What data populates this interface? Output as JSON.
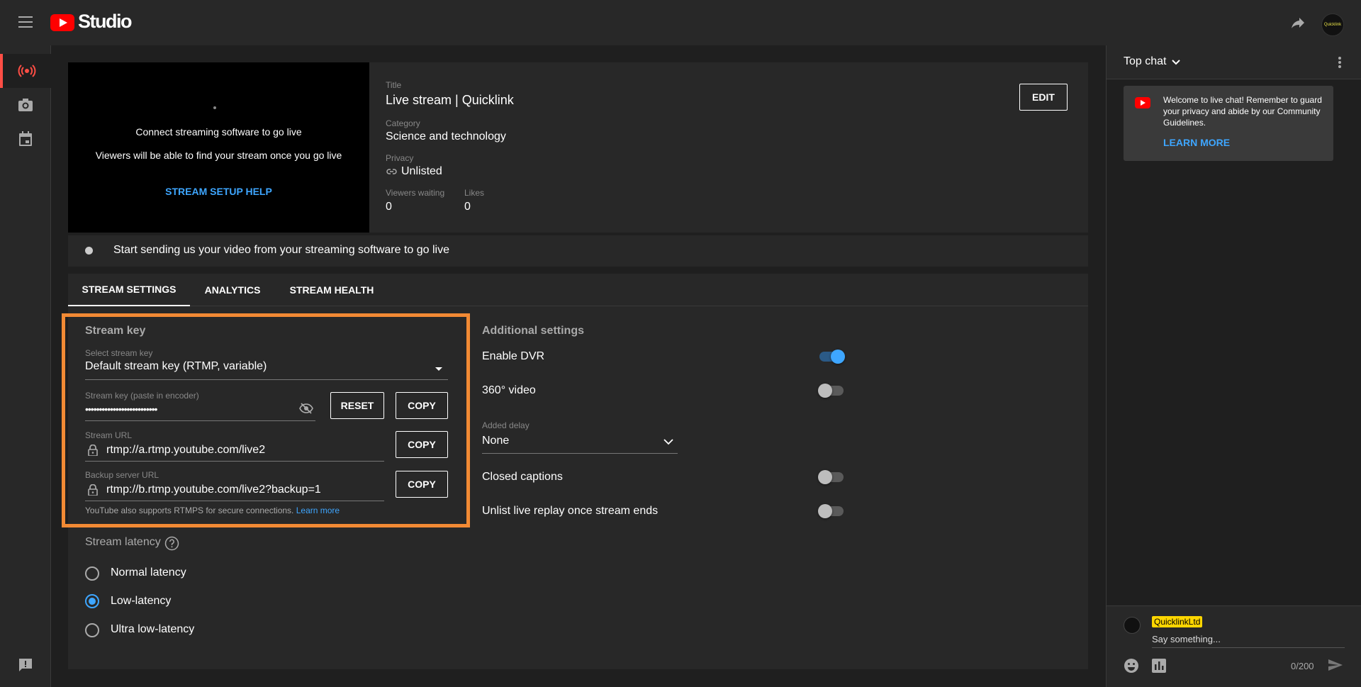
{
  "header": {
    "logo_text": "Studio",
    "avatar_text": "Quicklink"
  },
  "preview": {
    "line1": "Connect streaming software to go live",
    "line2": "Viewers will be able to find your stream once you go live",
    "help_link": "STREAM SETUP HELP"
  },
  "details": {
    "title_label": "Title",
    "title_value": "Live stream | Quicklink",
    "category_label": "Category",
    "category_value": "Science and technology",
    "privacy_label": "Privacy",
    "privacy_value": "Unlisted",
    "viewers_label": "Viewers waiting",
    "viewers_value": "0",
    "likes_label": "Likes",
    "likes_value": "0",
    "edit_button": "EDIT"
  },
  "status_bar": {
    "text": "Start sending us your video from your streaming software to go live"
  },
  "tabs": [
    {
      "label": "STREAM SETTINGS",
      "active": true
    },
    {
      "label": "ANALYTICS",
      "active": false
    },
    {
      "label": "STREAM HEALTH",
      "active": false
    }
  ],
  "stream_key": {
    "heading": "Stream key",
    "select_label": "Select stream key",
    "select_value": "Default stream key (RTMP, variable)",
    "key_label": "Stream key (paste in encoder)",
    "key_value": "••••••••••••••••••••••••••",
    "reset_button": "RESET",
    "copy_button": "COPY",
    "url_label": "Stream URL",
    "url_value": "rtmp://a.rtmp.youtube.com/live2",
    "backup_label": "Backup server URL",
    "backup_value": "rtmp://b.rtmp.youtube.com/live2?backup=1",
    "rtmps_note": "YouTube also supports RTMPS for secure connections.",
    "learn_more": "Learn more"
  },
  "latency": {
    "heading": "Stream latency",
    "options": [
      {
        "label": "Normal latency",
        "checked": false
      },
      {
        "label": "Low-latency",
        "checked": true
      },
      {
        "label": "Ultra low-latency",
        "checked": false
      }
    ]
  },
  "additional": {
    "heading": "Additional settings",
    "enable_dvr": "Enable DVR",
    "enable_dvr_on": true,
    "video_360": "360° video",
    "video_360_on": false,
    "delay_label": "Added delay",
    "delay_value": "None",
    "closed_captions": "Closed captions",
    "closed_captions_on": false,
    "unlist_replay": "Unlist live replay once stream ends",
    "unlist_replay_on": false
  },
  "chat": {
    "header": "Top chat",
    "welcome": "Welcome to live chat! Remember to guard your privacy and abide by our Community Guidelines.",
    "learn_more": "LEARN MORE",
    "username": "QuicklinkLtd",
    "placeholder": "Say something...",
    "counter": "0/200"
  },
  "colors": {
    "accent_blue": "#3ea6ff",
    "highlight_orange": "#f28a34",
    "brand_red": "#ff0000",
    "username_bg": "#ffd600"
  }
}
